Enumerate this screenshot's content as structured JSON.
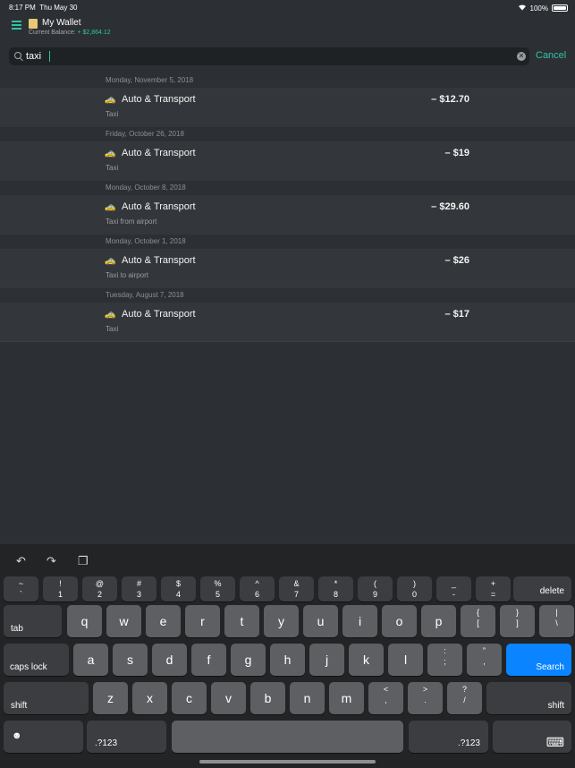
{
  "status": {
    "time": "8:17 PM",
    "date": "Thu May 30",
    "battery": "100%"
  },
  "header": {
    "title": "My Wallet",
    "balance_label": "Current Balance:",
    "balance_value": "+ $2,864.12"
  },
  "search": {
    "value": "taxi",
    "cancel_label": "Cancel"
  },
  "groups": [
    {
      "date": "Monday, November 5, 2018",
      "emoji": "🚕",
      "category": "Auto & Transport",
      "note": "Taxi",
      "amount": "– $12.70"
    },
    {
      "date": "Friday, October 26, 2018",
      "emoji": "🚕",
      "category": "Auto & Transport",
      "note": "Taxi",
      "amount": "– $19"
    },
    {
      "date": "Monday, October 8, 2018",
      "emoji": "🚕",
      "category": "Auto & Transport",
      "note": "Taxi from airport",
      "amount": "– $29.60"
    },
    {
      "date": "Monday, October 1, 2018",
      "emoji": "🚕",
      "category": "Auto & Transport",
      "note": "Taxi to airport",
      "amount": "– $26"
    },
    {
      "date": "Tuesday, August 7, 2018",
      "emoji": "🚕",
      "category": "Auto & Transport",
      "note": "Taxi",
      "amount": "– $17"
    }
  ],
  "keyboard": {
    "row1": [
      [
        "~",
        "`"
      ],
      [
        "!",
        "1"
      ],
      [
        "@",
        "2"
      ],
      [
        "#",
        "3"
      ],
      [
        "$",
        "4"
      ],
      [
        "%",
        "5"
      ],
      [
        "^",
        "6"
      ],
      [
        "&",
        "7"
      ],
      [
        "*",
        "8"
      ],
      [
        "(",
        "9"
      ],
      [
        ")",
        "0"
      ],
      [
        "_",
        "-"
      ],
      [
        "+",
        "="
      ]
    ],
    "delete": "delete",
    "tab": "tab",
    "row2": [
      "q",
      "w",
      "e",
      "r",
      "t",
      "y",
      "u",
      "i",
      "o",
      "p"
    ],
    "row2_punct": [
      [
        "{",
        "["
      ],
      [
        "}",
        "]"
      ],
      [
        "|",
        "\\"
      ]
    ],
    "caps": "caps lock",
    "row3": [
      "a",
      "s",
      "d",
      "f",
      "g",
      "h",
      "j",
      "k",
      "l"
    ],
    "row3_punct": [
      [
        ":",
        ";"
      ],
      [
        "”",
        ","
      ]
    ],
    "search": "Search",
    "shift": "shift",
    "row4": [
      "z",
      "x",
      "c",
      "v",
      "b",
      "n",
      "m"
    ],
    "row4_punct": [
      [
        "<",
        ","
      ],
      [
        ">",
        "."
      ],
      [
        "?",
        "/"
      ]
    ],
    "numbers": ".?123"
  },
  "colors": {
    "accent": "#2fc4a5",
    "search_key": "#0a84ff"
  }
}
